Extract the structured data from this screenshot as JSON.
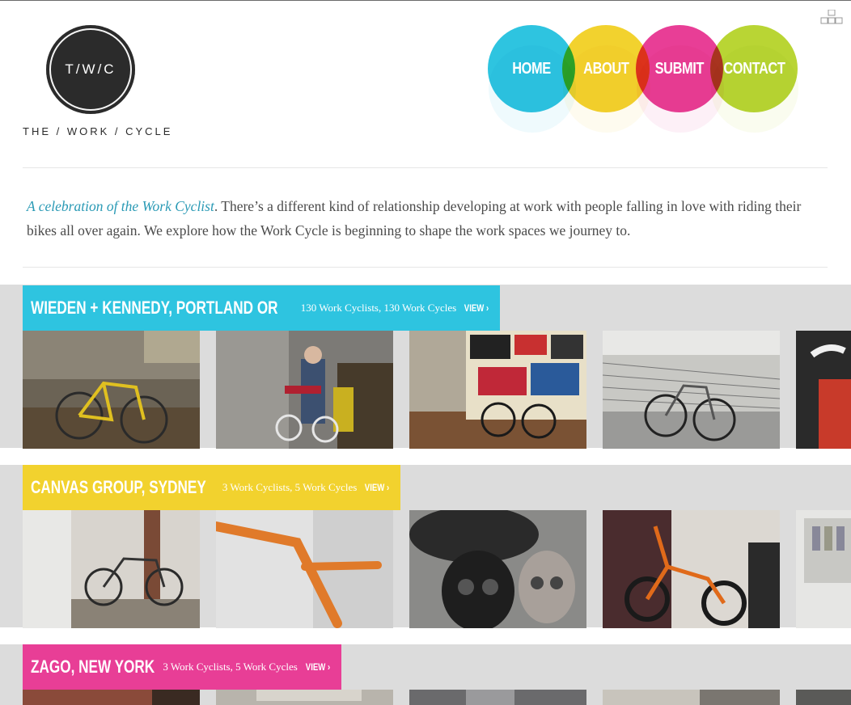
{
  "site": {
    "logo_mark": "T/W/C",
    "logo_text": "THE / WORK / CYCLE"
  },
  "nav": [
    {
      "label": "HOME",
      "color": "#2ec4e0"
    },
    {
      "label": "ABOUT",
      "color": "#f2d22e"
    },
    {
      "label": "SUBMIT",
      "color": "#e83e96"
    },
    {
      "label": "CONTACT",
      "color": "#b9d534"
    }
  ],
  "intro": {
    "lead": "A celebration of the Work Cyclist",
    "body": ". There’s a different kind of relationship developing at work with people falling in love with riding their bikes all over again. We explore how the Work Cycle is beginning to shape the work spaces we journey to."
  },
  "galleries": [
    {
      "name": "WIEDEN + KENNEDY, PORTLAND OR",
      "meta": "130 Work Cyclists, 130 Work Cycles",
      "view": "VIEW ›",
      "color": "#2ec4e0",
      "photos": [
        "yellow-bike-office",
        "man-with-bike",
        "bike-poster-wall",
        "bike-on-walkway",
        "handlebar-closeup"
      ]
    },
    {
      "name": "CANVAS GROUP, SYDNEY",
      "meta": "3 Work Cyclists, 5 Work Cycles",
      "view": "VIEW ›",
      "color": "#f2d22e",
      "photos": [
        "bike-near-chair",
        "orange-handlebar",
        "helmet-and-skulls",
        "orange-bmx",
        "office-shelves"
      ]
    },
    {
      "name": "ZAGO, NEW YORK",
      "meta": "3 Work Cyclists, 5 Work Cycles",
      "view": "VIEW ›",
      "color": "#e83e96",
      "photos": [
        "brick-wall",
        "columbe-sign",
        "window-building",
        "room-interior",
        "bike-partial"
      ]
    }
  ]
}
